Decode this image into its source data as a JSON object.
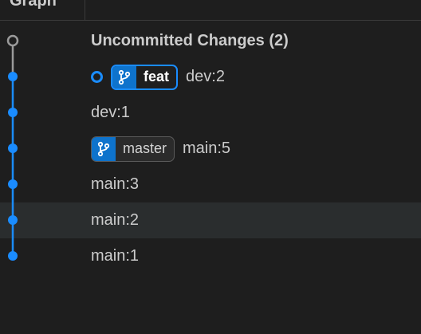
{
  "header": {
    "title": "Graph"
  },
  "colors": {
    "accent": "#1a8cff",
    "uncommitted": "#9a9a9a",
    "background": "#1e1e1e",
    "selected_row": "#2a2d2e",
    "text": "#cccccc"
  },
  "commits": [
    {
      "message": "Uncommitted Changes (2)",
      "kind": "uncommitted"
    },
    {
      "message": "dev:2",
      "kind": "commit",
      "badge": {
        "label": "feat",
        "icon": "git-branch-icon",
        "current": true
      },
      "head_marker": true
    },
    {
      "message": "dev:1",
      "kind": "commit"
    },
    {
      "message": "main:5",
      "kind": "commit",
      "badge": {
        "label": "master",
        "icon": "git-branch-icon",
        "current": false
      }
    },
    {
      "message": "main:3",
      "kind": "commit"
    },
    {
      "message": "main:2",
      "kind": "commit",
      "selected": true
    },
    {
      "message": "main:1",
      "kind": "commit"
    }
  ]
}
